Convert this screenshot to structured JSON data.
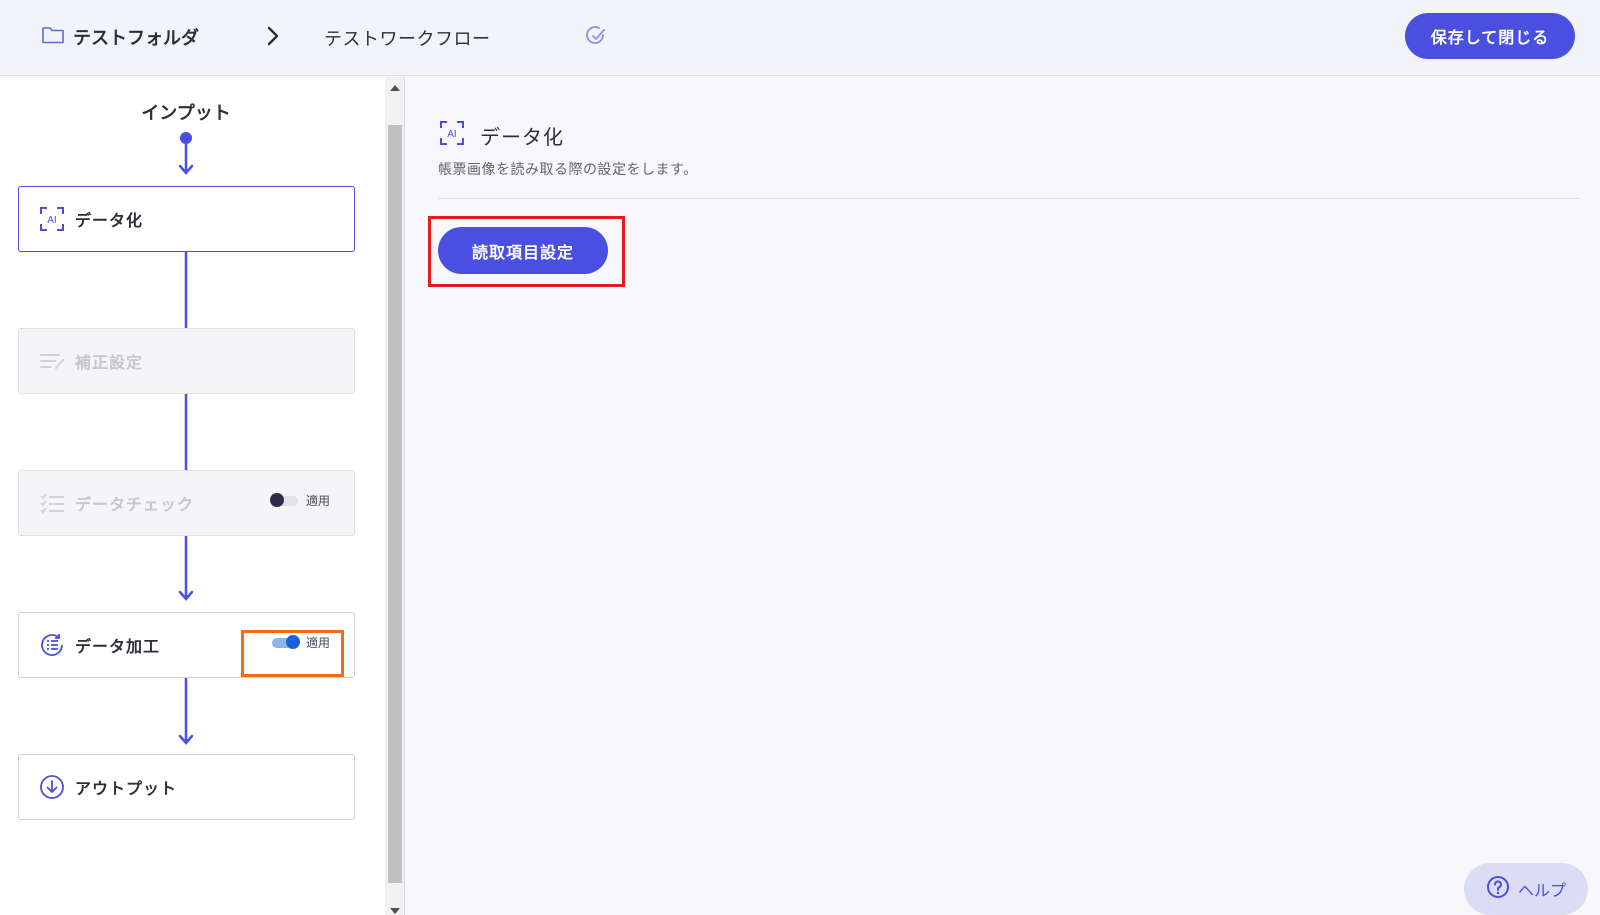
{
  "header": {
    "folder_name": "テストフォルダ",
    "workflow_name": "テストワークフロー",
    "save_close_label": "保存して閉じる"
  },
  "flow": {
    "input_label": "インプット",
    "steps": [
      {
        "label": "データ化",
        "state": "active",
        "icon": "ai-scan-icon"
      },
      {
        "label": "補正設定",
        "state": "disabled",
        "icon": "text-edit-icon"
      },
      {
        "label": "データチェック",
        "state": "disabled",
        "icon": "checklist-icon",
        "toggle_label": "適用",
        "toggle_on": false
      },
      {
        "label": "データ加工",
        "state": "enabled",
        "icon": "list-cycle-icon",
        "toggle_label": "適用",
        "toggle_on": true
      },
      {
        "label": "アウトプット",
        "state": "enabled",
        "icon": "download-circle-icon"
      }
    ]
  },
  "detail": {
    "title": "データ化",
    "icon": "ai-scan-icon",
    "description": "帳票画像を読み取る際の設定をします。",
    "read_items_button": "読取項目設定"
  },
  "help": {
    "label": "ヘルプ"
  },
  "colors": {
    "accent": "#4a4fdf",
    "highlight_red": "#e21b1b",
    "highlight_orange": "#f26b14",
    "toggle_on": "#1f5fd8"
  }
}
